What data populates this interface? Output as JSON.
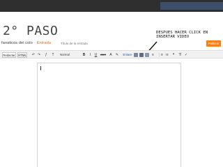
{
  "slide": {
    "title": "2° PASO",
    "annotation": "DESPUES HACER CLICK EN INSERTAR VIDEO"
  },
  "blogger": {
    "blog_name": "fanaticos del colo",
    "separator": "·",
    "entry_label": "Entrada",
    "post_title_placeholder": "Título de la entrada",
    "publish_label": "Publicar"
  },
  "toolbar": {
    "compose_tab": "Redactar",
    "html_tab": "HTML",
    "undo": "↶",
    "redo": "↷",
    "font_label": "ƒ",
    "font_size_label": "T",
    "format_label": "Normal",
    "bold_label": "B",
    "italic_label": "I",
    "underline_label": "U",
    "strike_label": "ABC",
    "text_color_label": "A",
    "highlight_label": "✎",
    "link_label": "Enlace",
    "align_label": "≡",
    "numbered_list_label": "⋮≡",
    "bullet_list_label": "⁝≡",
    "quote_label": "❝",
    "clear_label": "T̸",
    "spell_label": "✓"
  },
  "colors": {
    "topbar": "#2f2f30",
    "topbar_accent": "#3d4e6b",
    "publish_button": "#f58020",
    "entry_label": "#e0712e",
    "link": "#1a57b5"
  },
  "icons": {
    "image": "image-icon",
    "video": "video-icon",
    "jump_break": "jump-break-icon"
  }
}
